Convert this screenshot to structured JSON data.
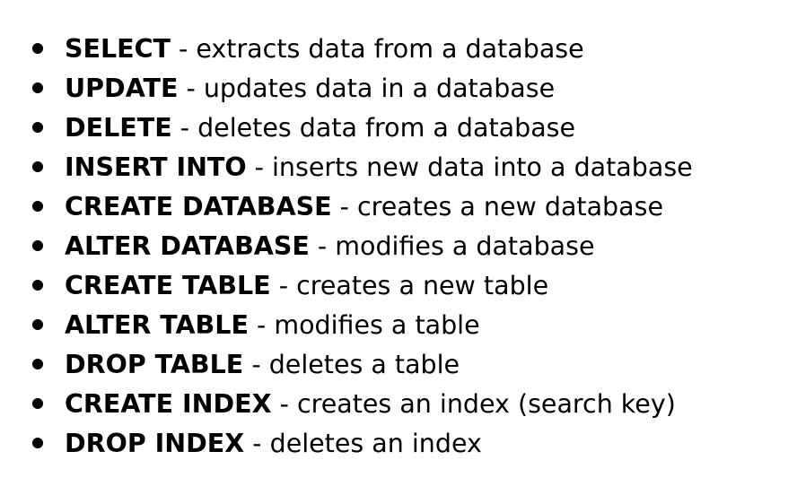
{
  "items": [
    {
      "command": "SELECT",
      "description": "extracts data from a database"
    },
    {
      "command": "UPDATE",
      "description": "updates data in a database"
    },
    {
      "command": "DELETE",
      "description": "deletes data from a database"
    },
    {
      "command": "INSERT INTO",
      "description": "inserts new data into a database"
    },
    {
      "command": "CREATE DATABASE",
      "description": "creates a new database"
    },
    {
      "command": "ALTER DATABASE",
      "description": "modifies a database"
    },
    {
      "command": "CREATE TABLE",
      "description": "creates a new table"
    },
    {
      "command": "ALTER TABLE",
      "description": "modifies a table"
    },
    {
      "command": "DROP TABLE",
      "description": "deletes a table"
    },
    {
      "command": "CREATE INDEX",
      "description": "creates an index (search key)"
    },
    {
      "command": "DROP INDEX",
      "description": "deletes an index"
    }
  ],
  "separator": " - "
}
